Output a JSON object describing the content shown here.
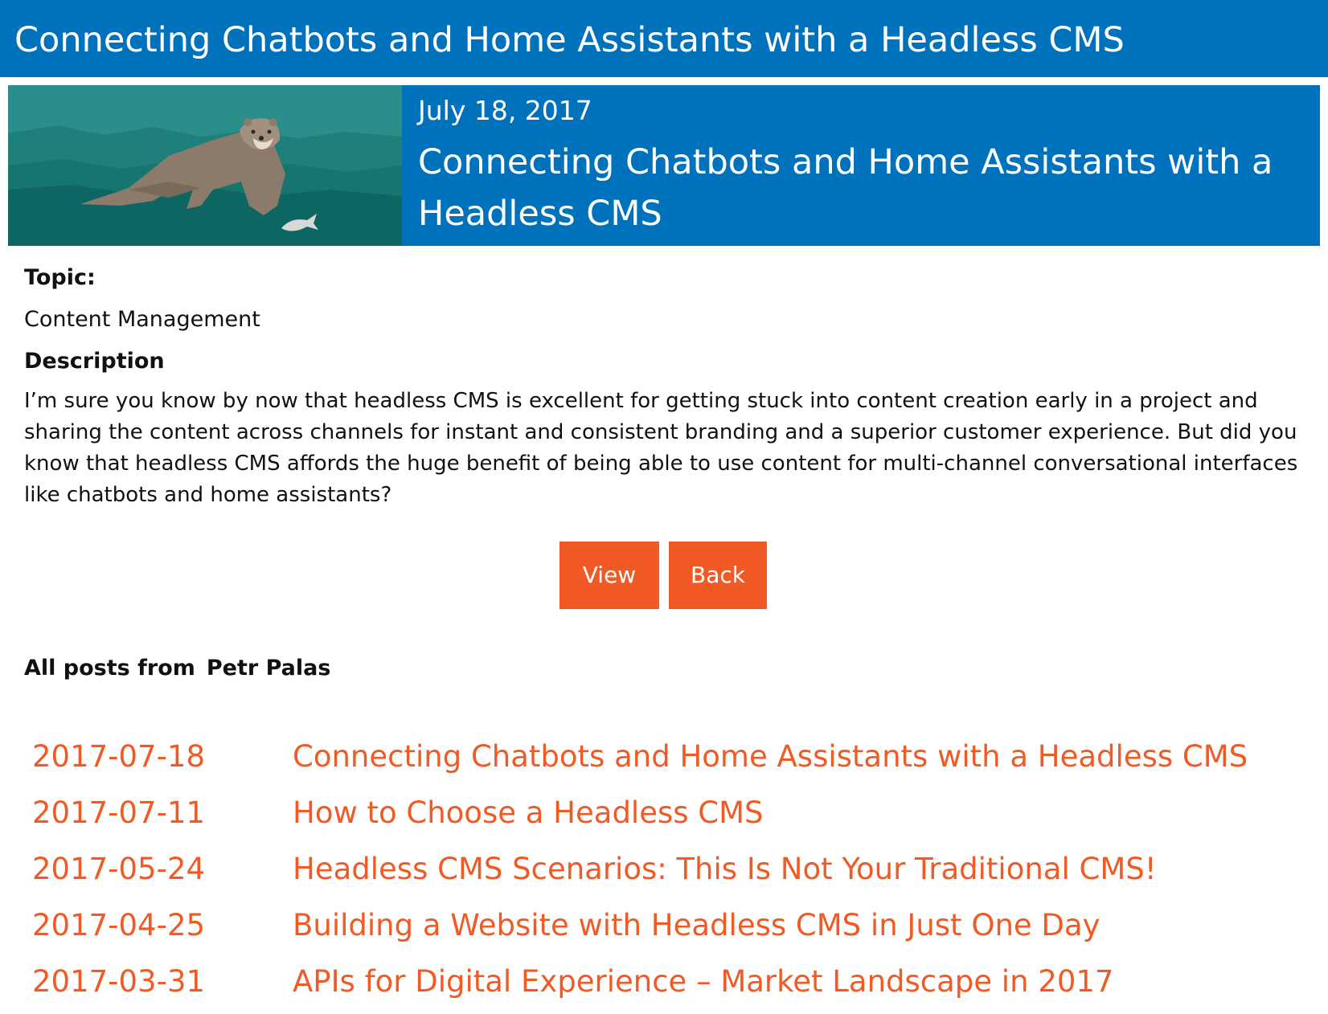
{
  "header": {
    "title": "Connecting Chatbots and Home Assistants with a Headless CMS"
  },
  "hero": {
    "date": "July 18, 2017",
    "title": "Connecting Chatbots and Home Assistants with a Headless CMS"
  },
  "details": {
    "topic_label": "Topic:",
    "topic_value": "Content Management",
    "description_label": "Description",
    "description_text": "I’m sure you know by now that headless CMS is excellent for getting stuck into content creation early in a project and sharing the content across channels for instant and consistent branding and a superior customer experience. But did you know that headless CMS affords the huge benefit of being able to use content for multi-channel conversational interfaces like chatbots and home assistants?"
  },
  "buttons": {
    "view_label": "View",
    "back_label": "Back"
  },
  "author": {
    "prefix": "All posts from",
    "name": "Petr Palas"
  },
  "posts": [
    {
      "date": "2017-07-18",
      "title": "Connecting Chatbots and Home Assistants with a Headless CMS"
    },
    {
      "date": "2017-07-11",
      "title": "How to Choose a Headless CMS"
    },
    {
      "date": "2017-05-24",
      "title": "Headless CMS Scenarios: This Is Not Your Traditional CMS!"
    },
    {
      "date": "2017-04-25",
      "title": "Building a Website with Headless CMS in Just One Day"
    },
    {
      "date": "2017-03-31",
      "title": "APIs for Digital Experience – Market Landscape in 2017"
    }
  ],
  "colors": {
    "header_blue": "#0072bc",
    "accent_orange": "#f15a24",
    "hero_teal": "#1f8c88"
  }
}
